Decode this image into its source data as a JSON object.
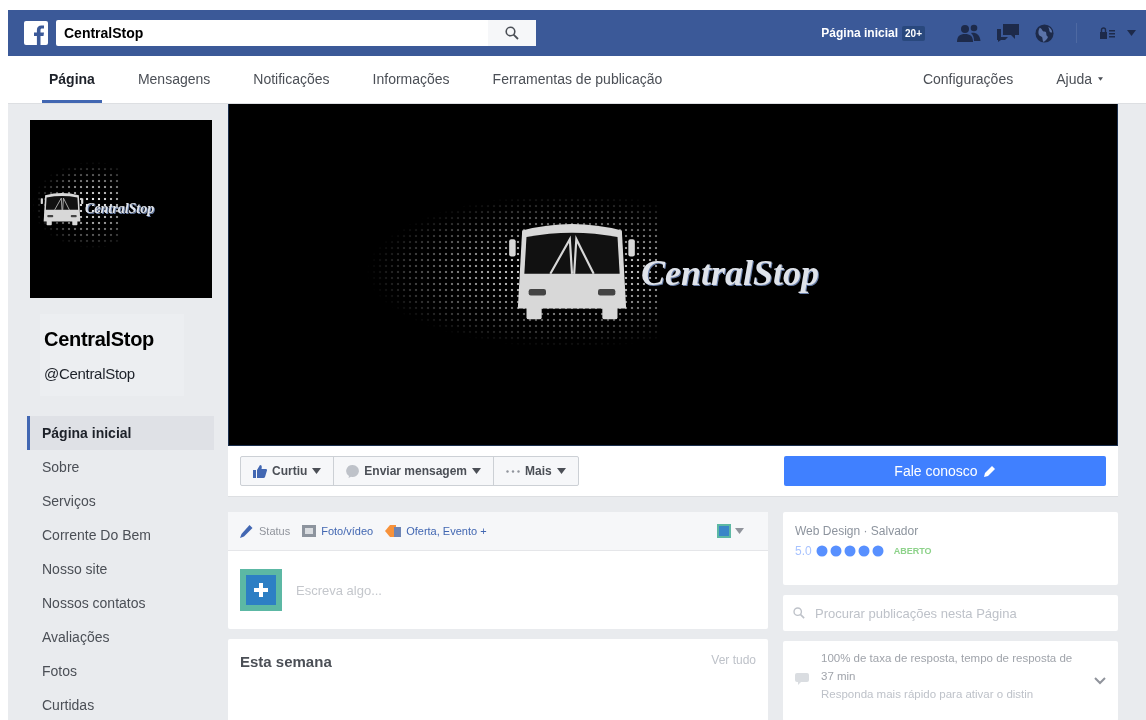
{
  "topbar": {
    "search_value": "CentralStop",
    "home_link": "Página inicial",
    "home_badge": "20+"
  },
  "tabs": [
    {
      "label": "Página",
      "selected": true
    },
    {
      "label": "Mensagens",
      "selected": false
    },
    {
      "label": "Notificações",
      "selected": false
    },
    {
      "label": "Informações",
      "selected": false
    },
    {
      "label": "Ferramentas de publicação",
      "selected": false
    }
  ],
  "tabs_right": [
    {
      "label": "Configurações",
      "menu": false
    },
    {
      "label": "Ajuda",
      "menu": true
    }
  ],
  "profile": {
    "logo_text": "CentralStop",
    "name": "CentralStop",
    "handle": "@CentralStop"
  },
  "sidebar": {
    "items": [
      {
        "label": "Página inicial",
        "selected": true
      },
      {
        "label": "Sobre",
        "selected": false
      },
      {
        "label": "Serviços",
        "selected": false
      },
      {
        "label": "Corrente Do Bem",
        "selected": false
      },
      {
        "label": "Nosso site",
        "selected": false
      },
      {
        "label": "Nossos contatos",
        "selected": false
      },
      {
        "label": "Avaliações",
        "selected": false
      },
      {
        "label": "Fotos",
        "selected": false
      },
      {
        "label": "Curtidas",
        "selected": false
      }
    ]
  },
  "cover": {
    "logo_text": "CentralStop"
  },
  "actions": [
    {
      "label": "Curtiu",
      "kind": "like"
    },
    {
      "label": "Enviar mensagem",
      "kind": "message"
    },
    {
      "label": "Mais",
      "kind": "more"
    }
  ],
  "contact_button": "Fale conosco",
  "composer": {
    "tabs": [
      {
        "label": "Status",
        "kind": "status"
      },
      {
        "label": "Foto/vídeo",
        "kind": "photo"
      },
      {
        "label": "Oferta, Evento +",
        "kind": "offer"
      }
    ],
    "placeholder": "Escreva algo..."
  },
  "week": {
    "title": "Esta semana",
    "link": "Ver tudo"
  },
  "about": {
    "category": "Web Design · Salvador",
    "rating": "5.0",
    "stars": 5,
    "status": "ABERTO"
  },
  "post_search": {
    "placeholder": "Procurar publicações nesta Página"
  },
  "response": {
    "text": "100% de taxa de resposta, tempo de resposta de 37 min",
    "hint": "Responda mais rápido para ativar o distin"
  }
}
